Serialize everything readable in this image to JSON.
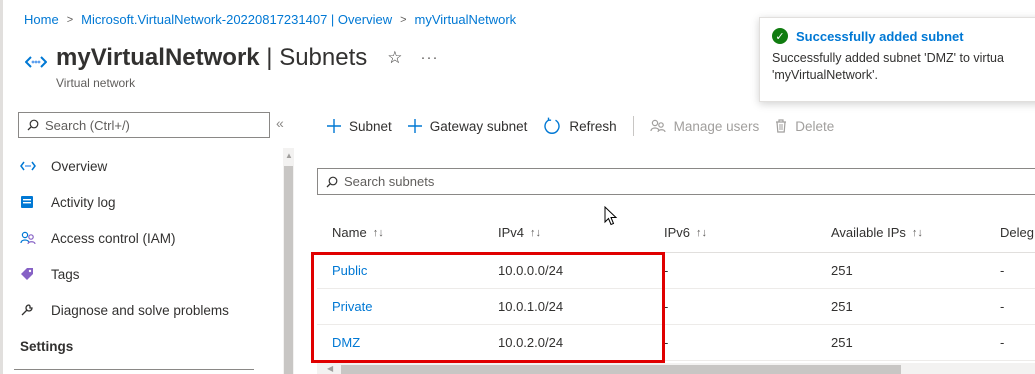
{
  "breadcrumb": {
    "items": [
      "Home",
      "Microsoft.VirtualNetwork-20220817231407 | Overview",
      "myVirtualNetwork"
    ],
    "separator": ">"
  },
  "header": {
    "resource_name": "myVirtualNetwork",
    "page_name": "| Subnets",
    "subtitle": "Virtual network",
    "favorite_icon": "star-icon",
    "more_label": "···"
  },
  "notification": {
    "title": "Successfully added subnet",
    "message_line1": "Successfully added subnet 'DMZ' to virtua",
    "message_line2": "'myVirtualNetwork'.",
    "status_color": "#107c10"
  },
  "sidebar": {
    "search_placeholder": "Search (Ctrl+/)",
    "collapse_label": "«",
    "items": [
      {
        "label": "Overview",
        "icon": "vnet-icon"
      },
      {
        "label": "Activity log",
        "icon": "activity-log-icon"
      },
      {
        "label": "Access control (IAM)",
        "icon": "people-icon"
      },
      {
        "label": "Tags",
        "icon": "tag-icon"
      },
      {
        "label": "Diagnose and solve problems",
        "icon": "wrench-icon"
      }
    ],
    "section_settings": "Settings"
  },
  "toolbar": {
    "add_subnet": "Subnet",
    "add_gateway_subnet": "Gateway subnet",
    "refresh": "Refresh",
    "manage_users": "Manage users",
    "delete": "Delete"
  },
  "subnets": {
    "search_placeholder": "Search subnets",
    "columns": [
      "Name",
      "IPv4",
      "IPv6",
      "Available IPs",
      "Deleg"
    ],
    "sort_glyph": "↑↓",
    "rows": [
      {
        "name": "Public",
        "ipv4": "10.0.0.0/24",
        "ipv6": "-",
        "available": "251",
        "deleg": "-"
      },
      {
        "name": "Private",
        "ipv4": "10.0.1.0/24",
        "ipv6": "-",
        "available": "251",
        "deleg": "-"
      },
      {
        "name": "DMZ",
        "ipv4": "10.0.2.0/24",
        "ipv6": "-",
        "available": "251",
        "deleg": "-"
      }
    ]
  },
  "colors": {
    "accent": "#0078d4",
    "highlight_box": "#e00000"
  }
}
